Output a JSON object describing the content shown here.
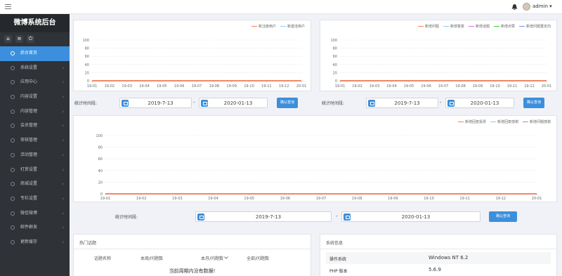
{
  "app": {
    "title": "微博系统后台"
  },
  "topbar": {
    "username": "admin ▾"
  },
  "sidebar": {
    "quick_icons": [
      "home-icon",
      "list-icon",
      "power-icon"
    ],
    "items": [
      {
        "label": "后台首页",
        "active": true
      },
      {
        "label": "系统设置"
      },
      {
        "label": "应用中心"
      },
      {
        "label": "内容设置"
      },
      {
        "label": "内容管理"
      },
      {
        "label": "会员管理"
      },
      {
        "label": "审核管理"
      },
      {
        "label": "活动管理"
      },
      {
        "label": "打赏设置"
      },
      {
        "label": "商城设置"
      },
      {
        "label": "专栏设置"
      },
      {
        "label": "微信微博"
      },
      {
        "label": "邮件群发"
      },
      {
        "label": "更新缓存"
      }
    ]
  },
  "filter": {
    "label": "统计时间段:",
    "start": "2019-7-13",
    "end": "2020-01-13",
    "dash": "-",
    "button": "确认查询"
  },
  "chart_data": [
    {
      "type": "line",
      "categories": [
        "19-01",
        "19-02",
        "19-03",
        "19-04",
        "19-05",
        "19-06",
        "19-07",
        "19-08",
        "19-09",
        "19-10",
        "19-11",
        "19-12",
        "20-01"
      ],
      "ylim": [
        0,
        100
      ],
      "yticks": [
        0,
        20,
        40,
        60,
        80,
        100
      ],
      "legend_position": "top-right",
      "series": [
        {
          "name": "新注册用户",
          "color": "#ff7f50",
          "values": [
            0,
            0,
            0,
            0,
            0,
            0,
            0,
            0,
            0,
            0,
            0,
            0,
            0
          ]
        },
        {
          "name": "新激活用户",
          "color": "#87cefa",
          "values": [
            0,
            0,
            0,
            0,
            0,
            0,
            0,
            0,
            0,
            0,
            0,
            0,
            0
          ]
        }
      ]
    },
    {
      "type": "line",
      "categories": [
        "19-01",
        "19-02",
        "19-03",
        "19-04",
        "19-05",
        "19-06",
        "19-07",
        "19-08",
        "19-09",
        "19-10",
        "19-11",
        "19-12",
        "20-01"
      ],
      "ylim": [
        0,
        100
      ],
      "yticks": [
        0,
        20,
        40,
        60,
        80,
        100
      ],
      "legend_position": "top-right",
      "series": [
        {
          "name": "新增问题",
          "color": "#ff7f50",
          "values": [
            0,
            0,
            0,
            0,
            0,
            0,
            0,
            0,
            0,
            0,
            0,
            0,
            0
          ]
        },
        {
          "name": "新增答复",
          "color": "#87cefa",
          "values": [
            0,
            0,
            0,
            0,
            0,
            0,
            0,
            0,
            0,
            0,
            0,
            0,
            0
          ]
        },
        {
          "name": "新增话题",
          "color": "#da70d6",
          "values": [
            0,
            0,
            0,
            0,
            0,
            0,
            0,
            0,
            0,
            0,
            0,
            0,
            0
          ]
        },
        {
          "name": "新增点赞",
          "color": "#32cd32",
          "values": [
            0,
            0,
            0,
            0,
            0,
            0,
            0,
            0,
            0,
            0,
            0,
            0,
            0
          ]
        },
        {
          "name": "新增问题重定向",
          "color": "#6495ed",
          "values": [
            0,
            0,
            0,
            0,
            0,
            0,
            0,
            0,
            0,
            0,
            0,
            0,
            0
          ]
        }
      ]
    },
    {
      "type": "line",
      "categories": [
        "19-01",
        "19-02",
        "19-03",
        "19-04",
        "19-05",
        "19-06",
        "19-07",
        "19-08",
        "19-09",
        "19-10",
        "19-11",
        "19-12",
        "20-01"
      ],
      "ylim": [
        0,
        100
      ],
      "yticks": [
        0,
        20,
        40,
        60,
        80,
        100
      ],
      "legend_position": "top-right",
      "series": [
        {
          "name": "新增回复投票",
          "color": "#ff7f50",
          "values": [
            0,
            0,
            0,
            0,
            0,
            0,
            0,
            0,
            0,
            0,
            0,
            0,
            0
          ]
        },
        {
          "name": "新增回复感谢",
          "color": "#87cefa",
          "values": [
            0,
            0,
            0,
            0,
            0,
            0,
            0,
            0,
            0,
            0,
            0,
            0,
            0
          ]
        },
        {
          "name": "新增问题感谢",
          "color": "#da70d6",
          "values": [
            0,
            0,
            0,
            0,
            0,
            0,
            0,
            0,
            0,
            0,
            0,
            0,
            0
          ]
        }
      ]
    }
  ],
  "hot_topics": {
    "title": "热门话题",
    "columns": [
      "话题名称",
      "本周/问题数",
      "本月/问题数",
      "全部/问题数"
    ],
    "sort_icon": "chevron-down-icon",
    "empty_text": "当前周期内没有数据!"
  },
  "system_info": {
    "title": "系统信息",
    "rows": [
      {
        "key": "操作系统",
        "value": "Windows NT 6.2"
      },
      {
        "key": "PHP 版本",
        "value": "5.6.9"
      }
    ]
  }
}
